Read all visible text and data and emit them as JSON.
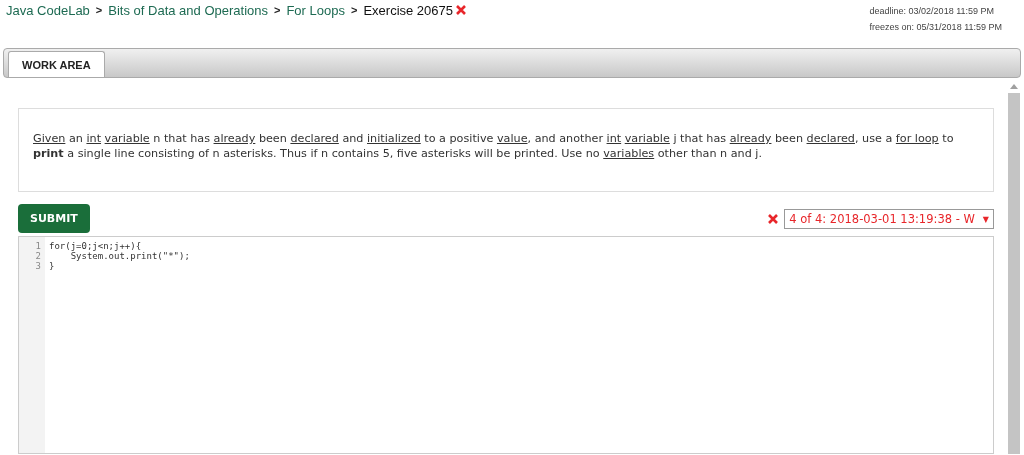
{
  "breadcrumb": {
    "items": [
      {
        "label": "Java CodeLab"
      },
      {
        "label": "Bits of Data and Operations"
      },
      {
        "label": "For Loops"
      }
    ],
    "separator": ">",
    "current": "Exercise 20675",
    "wrong": true
  },
  "dates": {
    "deadline": "deadline: 03/02/2018 11:59 PM",
    "freezes": "freezes on: 05/31/2018 11:59 PM"
  },
  "tabs": [
    {
      "label": "WORK AREA",
      "selected": true
    }
  ],
  "instructions": [
    {
      "kind": "link",
      "text": "Given"
    },
    {
      "kind": "plain",
      "text": " an "
    },
    {
      "kind": "link",
      "text": "int",
      "space_after": true
    },
    {
      "kind": "link",
      "text": "variable"
    },
    {
      "kind": "plain",
      "text": " n that has "
    },
    {
      "kind": "link",
      "text": "already"
    },
    {
      "kind": "plain",
      "text": " been "
    },
    {
      "kind": "link",
      "text": "declared"
    },
    {
      "kind": "plain",
      "text": " and "
    },
    {
      "kind": "link",
      "text": "initialized"
    },
    {
      "kind": "plain",
      "text": " to a positive "
    },
    {
      "kind": "link",
      "text": "value"
    },
    {
      "kind": "plain",
      "text": ", and another "
    },
    {
      "kind": "link",
      "text": "int",
      "space_after": true
    },
    {
      "kind": "link",
      "text": "variable"
    },
    {
      "kind": "plain",
      "text": " j that has "
    },
    {
      "kind": "link",
      "text": "already"
    },
    {
      "kind": "plain",
      "text": " been "
    },
    {
      "kind": "link",
      "text": "declared"
    },
    {
      "kind": "plain",
      "text": ", use a "
    },
    {
      "kind": "link",
      "text": "for loop"
    },
    {
      "kind": "plain",
      "text": " to "
    },
    {
      "kind": "bold",
      "text": "print"
    },
    {
      "kind": "plain",
      "text": " a single line consisting of n asterisks. Thus if n contains 5, five asterisks will be printed. Use no "
    },
    {
      "kind": "link",
      "text": "variables"
    },
    {
      "kind": "plain",
      "text": " other than n and j."
    }
  ],
  "submit": {
    "label": "SUBMIT"
  },
  "submissions": {
    "wrong": true,
    "selected_value": "4 of 4: 2018-03-01 13:19:38 - W",
    "caret": "▼"
  },
  "code": [
    {
      "number": "1",
      "text": "for(j=0;j<n;j++){"
    },
    {
      "number": "2",
      "text": "    System.out.print(\"*\");"
    },
    {
      "number": "3",
      "text": "}"
    }
  ]
}
